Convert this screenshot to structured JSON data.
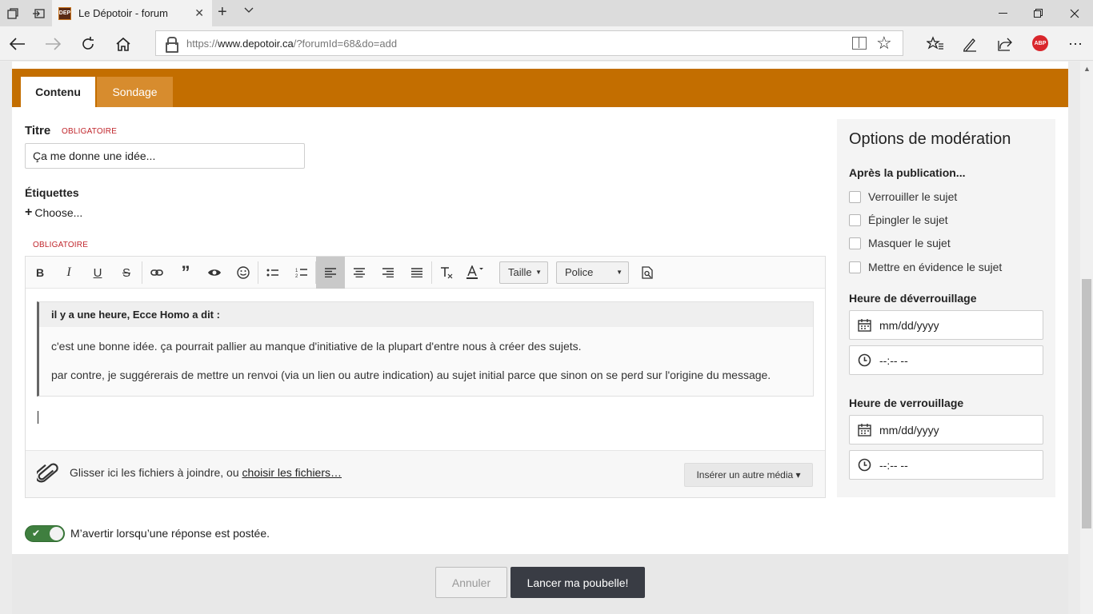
{
  "browser": {
    "tab_title": "Le Dépotoir - forum",
    "url_prefix": "https://",
    "url_host": "www.depotoir.ca",
    "url_path": "/?forumId=68&do=add",
    "favicon_text": "DEP",
    "adblock_badge": "ABP"
  },
  "tabs": [
    {
      "label": "Contenu",
      "active": true
    },
    {
      "label": "Sondage",
      "active": false
    }
  ],
  "form": {
    "title_label": "Titre",
    "required_label": "OBLIGATOIRE",
    "title_value": "Ça me donne une idée...",
    "tags_label": "Étiquettes",
    "tags_choose": "Choose...",
    "body_required_label": "OBLIGATOIRE"
  },
  "toolbar": {
    "size_select": "Taille",
    "font_select": "Police"
  },
  "quote": {
    "header": "il y a une heure, Ecce Homo a dit :",
    "lines": [
      "c'est une bonne idée. ça pourrait pallier au manque d'initiative de la plupart d'entre nous à créer des sujets.",
      "par contre, je suggérerais de mettre un renvoi (via un lien ou autre indication) au sujet initial parce que sinon on se perd sur l'origine du message."
    ]
  },
  "attachments": {
    "text": "Glisser ici les fichiers à joindre, ou ",
    "link": "choisir les fichiers…",
    "media_button": "Insérer un autre média ▾"
  },
  "moderation": {
    "title": "Options de modération",
    "after_label": "Après la publication...",
    "options": [
      "Verrouiller le sujet",
      "Épingler le sujet",
      "Masquer le sujet",
      "Mettre en évidence le sujet"
    ],
    "unlock_label": "Heure de déverrouillage",
    "lock_label": "Heure de verrouillage",
    "date_placeholder": "mm/dd/yyyy",
    "time_placeholder": "--:-- --"
  },
  "notify": {
    "label": "M’avertir lorsqu’une réponse est postée.",
    "enabled": true
  },
  "footer": {
    "cancel": "Annuler",
    "submit": "Lancer ma poubelle!"
  }
}
